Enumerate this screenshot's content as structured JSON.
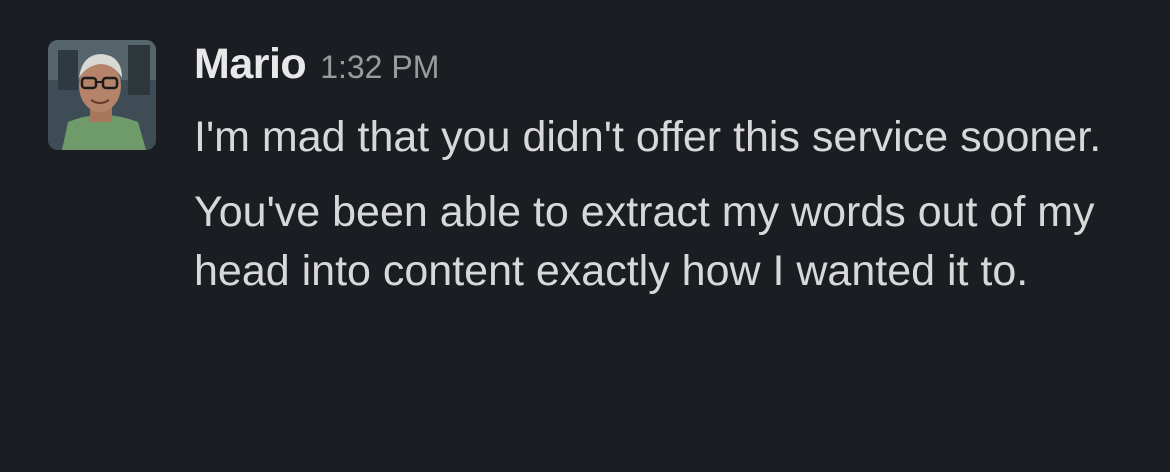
{
  "message": {
    "author": "Mario",
    "timestamp": "1:32 PM",
    "paragraphs": [
      "I'm mad that you didn't offer this service sooner.",
      "You've been able to extract my words out of my head into content exactly how I wanted it to."
    ]
  },
  "avatar": {
    "icon": "user-avatar-photo"
  },
  "colors": {
    "background": "#1a1d21",
    "author": "#e8e8e8",
    "timestamp": "#9a9b9d",
    "text": "#d8d8d9"
  }
}
